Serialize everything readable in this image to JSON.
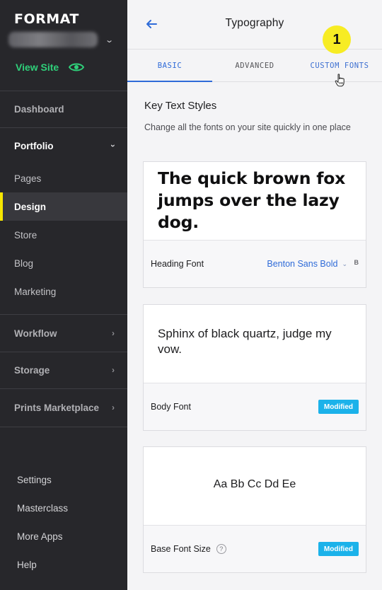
{
  "sidebar": {
    "brand": "FORMAT",
    "view_site": "View Site",
    "items": [
      {
        "label": "Dashboard"
      },
      {
        "label": "Portfolio"
      },
      {
        "label": "Pages"
      },
      {
        "label": "Design"
      },
      {
        "label": "Store"
      },
      {
        "label": "Blog"
      },
      {
        "label": "Marketing"
      },
      {
        "label": "Workflow"
      },
      {
        "label": "Storage"
      },
      {
        "label": "Prints Marketplace"
      }
    ],
    "footer": [
      {
        "label": "Settings"
      },
      {
        "label": "Masterclass"
      },
      {
        "label": "More Apps"
      },
      {
        "label": "Help"
      }
    ],
    "active_item": "Design",
    "accent_active": "#f6e600",
    "view_site_color": "#2fd07a"
  },
  "header": {
    "title": "Typography",
    "back_icon": "arrow-left-icon"
  },
  "tabs": [
    {
      "label": "BASIC",
      "active": true
    },
    {
      "label": "ADVANCED",
      "active": false
    },
    {
      "label": "CUSTOM FONTS",
      "active": false
    }
  ],
  "annotation": {
    "step": "1",
    "color": "#f7ec24"
  },
  "section": {
    "title": "Key Text Styles",
    "description": "Change all the fonts on your site quickly in one place"
  },
  "cards": {
    "heading": {
      "sample": "The quick brown fox jumps over the lazy dog.",
      "label": "Heading Font",
      "font_value": "Benton Sans Bold",
      "extra": "B"
    },
    "body": {
      "sample": "Sphinx of black quartz, judge my vow.",
      "label": "Body Font",
      "badge": "Modified"
    },
    "base": {
      "sample": "Aa Bb Cc Dd Ee",
      "label": "Base Font Size",
      "help": "?",
      "badge": "Modified"
    }
  },
  "colors": {
    "accent_blue": "#2f6bd8",
    "badge_blue": "#1bb2ea",
    "sidebar_bg": "#27272b"
  }
}
